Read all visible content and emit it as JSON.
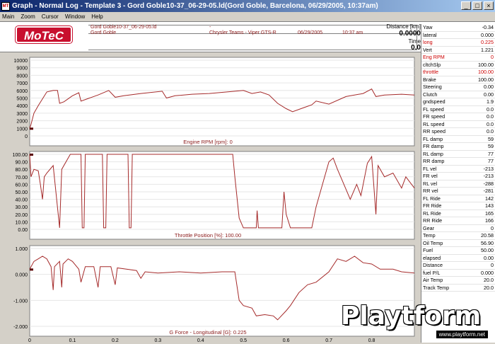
{
  "window": {
    "title": "Graph - Normal Log - Template 3 - Gord Goble10-37_06-29-05.ld(Gord Goble, Barcelona, 06/29/2005, 10:37am)",
    "icon_label": "MT",
    "buttons": {
      "minimize": "_",
      "maximize": "□",
      "close": "×"
    }
  },
  "menu": [
    "Main",
    "Zoom",
    "Cursor",
    "Window",
    "Help"
  ],
  "header": {
    "logo": "MoTeC",
    "file": "Gord Goble10-37_06-29-05.ld",
    "driver": "Gord Goble",
    "dash": "-",
    "team": "Chrysler Teams - Viper GTS-R",
    "date": "06/29/2005",
    "time": "10:37 am",
    "distance_label": "Distance [km]",
    "distance_value": "0.0000",
    "time_label": "Time",
    "time_value": "0.0"
  },
  "chart_data": [
    {
      "type": "line",
      "title": "Engine RPM [rpm]: 0",
      "ylim": [
        0,
        10000
      ],
      "yticks": [
        "10000",
        "9000",
        "8000",
        "7000",
        "6000",
        "5000",
        "4000",
        "3000",
        "2000",
        "1000",
        "0"
      ],
      "series": [
        {
          "values_xy": [
            [
              0,
              1000
            ],
            [
              0.003,
              1500
            ],
            [
              0.01,
              3000
            ],
            [
              0.02,
              4000
            ],
            [
              0.04,
              5800
            ],
            [
              0.055,
              6000
            ],
            [
              0.065,
              6000
            ],
            [
              0.07,
              4300
            ],
            [
              0.08,
              4500
            ],
            [
              0.1,
              5300
            ],
            [
              0.115,
              5700
            ],
            [
              0.12,
              4600
            ],
            [
              0.14,
              5000
            ],
            [
              0.16,
              5400
            ],
            [
              0.185,
              6000
            ],
            [
              0.2,
              5100
            ],
            [
              0.22,
              5300
            ],
            [
              0.26,
              5600
            ],
            [
              0.31,
              5900
            ],
            [
              0.32,
              5000
            ],
            [
              0.34,
              5300
            ],
            [
              0.38,
              5500
            ],
            [
              0.42,
              5600
            ],
            [
              0.48,
              5900
            ],
            [
              0.5,
              6000
            ],
            [
              0.52,
              5600
            ],
            [
              0.54,
              5800
            ],
            [
              0.56,
              5400
            ],
            [
              0.58,
              4300
            ],
            [
              0.6,
              3600
            ],
            [
              0.615,
              3200
            ],
            [
              0.64,
              3700
            ],
            [
              0.66,
              4100
            ],
            [
              0.67,
              4600
            ],
            [
              0.7,
              4200
            ],
            [
              0.74,
              5200
            ],
            [
              0.78,
              5600
            ],
            [
              0.8,
              6200
            ],
            [
              0.81,
              5200
            ],
            [
              0.83,
              5400
            ],
            [
              0.87,
              5500
            ],
            [
              0.9,
              5400
            ]
          ]
        }
      ]
    },
    {
      "type": "line",
      "title": "Throttle Position [%]: 100.00",
      "ylim": [
        0,
        100
      ],
      "yticks": [
        "100.00",
        "90.00",
        "80.00",
        "70.00",
        "60.00",
        "50.00",
        "40.00",
        "30.00",
        "20.00",
        "10.00",
        "0.00"
      ],
      "series": [
        {
          "values_xy": [
            [
              0,
              100
            ],
            [
              0.003,
              70
            ],
            [
              0.01,
              80
            ],
            [
              0.02,
              78
            ],
            [
              0.025,
              60
            ],
            [
              0.03,
              40
            ],
            [
              0.034,
              70
            ],
            [
              0.04,
              75
            ],
            [
              0.055,
              85
            ],
            [
              0.07,
              2
            ],
            [
              0.075,
              80
            ],
            [
              0.095,
              100
            ],
            [
              0.12,
              100
            ],
            [
              0.123,
              2
            ],
            [
              0.127,
              2
            ],
            [
              0.13,
              100
            ],
            [
              0.17,
              100
            ],
            [
              0.173,
              2
            ],
            [
              0.178,
              2
            ],
            [
              0.181,
              100
            ],
            [
              0.23,
              100
            ],
            [
              0.233,
              2
            ],
            [
              0.237,
              2
            ],
            [
              0.24,
              100
            ],
            [
              0.3,
              100
            ],
            [
              0.44,
              100
            ],
            [
              0.475,
              100
            ],
            [
              0.48,
              70
            ],
            [
              0.49,
              15
            ],
            [
              0.5,
              2
            ],
            [
              0.53,
              2
            ],
            [
              0.532,
              25
            ],
            [
              0.535,
              2
            ],
            [
              0.59,
              2
            ],
            [
              0.595,
              50
            ],
            [
              0.6,
              20
            ],
            [
              0.61,
              2
            ],
            [
              0.66,
              2
            ],
            [
              0.67,
              30
            ],
            [
              0.7,
              90
            ],
            [
              0.71,
              95
            ],
            [
              0.72,
              80
            ],
            [
              0.735,
              60
            ],
            [
              0.75,
              40
            ],
            [
              0.765,
              60
            ],
            [
              0.775,
              45
            ],
            [
              0.79,
              88
            ],
            [
              0.8,
              97
            ],
            [
              0.81,
              20
            ],
            [
              0.815,
              85
            ],
            [
              0.83,
              70
            ],
            [
              0.85,
              75
            ],
            [
              0.87,
              55
            ],
            [
              0.88,
              70
            ],
            [
              0.9,
              55
            ]
          ]
        }
      ]
    },
    {
      "type": "line",
      "title": "G Force - Longitudinal [G]: 0.225",
      "ylim": [
        -2,
        1
      ],
      "yticks": [
        "1.000",
        "0.000",
        "-1.000",
        "-2.000"
      ],
      "xlim": [
        0,
        0.9
      ],
      "xticks": [
        "0",
        "0.1",
        "0.2",
        "0.3",
        "0.4",
        "0.5",
        "0.6",
        "0.7",
        "0.8"
      ],
      "series": [
        {
          "values_xy": [
            [
              0,
              0.2
            ],
            [
              0.01,
              0.5
            ],
            [
              0.02,
              0.6
            ],
            [
              0.03,
              0.7
            ],
            [
              0.04,
              0.6
            ],
            [
              0.05,
              0.3
            ],
            [
              0.055,
              -0.6
            ],
            [
              0.058,
              0.3
            ],
            [
              0.07,
              0.5
            ],
            [
              0.075,
              -0.5
            ],
            [
              0.078,
              0.4
            ],
            [
              0.09,
              0.6
            ],
            [
              0.1,
              0.5
            ],
            [
              0.115,
              0.2
            ],
            [
              0.12,
              -0.3
            ],
            [
              0.13,
              0.3
            ],
            [
              0.15,
              0.3
            ],
            [
              0.16,
              -0.5
            ],
            [
              0.165,
              0.3
            ],
            [
              0.19,
              0.3
            ],
            [
              0.2,
              -0.4
            ],
            [
              0.205,
              0.25
            ],
            [
              0.25,
              0.15
            ],
            [
              0.26,
              -0.15
            ],
            [
              0.27,
              0.1
            ],
            [
              0.3,
              0.05
            ],
            [
              0.35,
              0.1
            ],
            [
              0.4,
              0.05
            ],
            [
              0.45,
              0.1
            ],
            [
              0.48,
              0.1
            ],
            [
              0.49,
              -1.0
            ],
            [
              0.5,
              -1.2
            ],
            [
              0.52,
              -1.3
            ],
            [
              0.53,
              -1.6
            ],
            [
              0.55,
              -1.55
            ],
            [
              0.57,
              -1.6
            ],
            [
              0.58,
              -1.75
            ],
            [
              0.6,
              -1.4
            ],
            [
              0.61,
              -1.2
            ],
            [
              0.63,
              -0.7
            ],
            [
              0.65,
              -0.4
            ],
            [
              0.67,
              -0.3
            ],
            [
              0.7,
              0.1
            ],
            [
              0.72,
              0.6
            ],
            [
              0.74,
              0.5
            ],
            [
              0.76,
              0.7
            ],
            [
              0.78,
              0.45
            ],
            [
              0.8,
              0.4
            ],
            [
              0.82,
              0.2
            ],
            [
              0.85,
              0.2
            ],
            [
              0.87,
              0.1
            ],
            [
              0.9,
              0.05
            ]
          ]
        }
      ]
    }
  ],
  "channels": [
    {
      "name": "Yaw",
      "value": "-0.34",
      "red": false
    },
    {
      "name": "lateral",
      "value": "0.000",
      "red": false
    },
    {
      "name": "long",
      "value": "0.225",
      "red": true
    },
    {
      "name": "Vert",
      "value": "1.221",
      "red": false
    },
    {
      "name": "Eng RPM",
      "value": "0",
      "red": true
    },
    {
      "name": "cltchSlp",
      "value": "100.00",
      "red": false
    },
    {
      "name": "throttle",
      "value": "100.00",
      "red": true
    },
    {
      "name": "Brake",
      "value": "100.00",
      "red": false
    },
    {
      "name": "Steering",
      "value": "0.00",
      "red": false
    },
    {
      "name": "Clutch",
      "value": "0.00",
      "red": false
    },
    {
      "name": "gndspeed",
      "value": "1.9",
      "red": false
    },
    {
      "name": "FL speed",
      "value": "0.0",
      "red": false
    },
    {
      "name": "FR speed",
      "value": "0.0",
      "red": false
    },
    {
      "name": "RL speed",
      "value": "0.0",
      "red": false
    },
    {
      "name": "RR speed",
      "value": "0.0",
      "red": false
    },
    {
      "name": "FL damp",
      "value": "59",
      "red": false
    },
    {
      "name": "FR damp",
      "value": "59",
      "red": false
    },
    {
      "name": "RL damp",
      "value": "77",
      "red": false
    },
    {
      "name": "RR damp",
      "value": "77",
      "red": false
    },
    {
      "name": "FL vel",
      "value": "-213",
      "red": false
    },
    {
      "name": "FR vel",
      "value": "-213",
      "red": false
    },
    {
      "name": "RL vel",
      "value": "-288",
      "red": false
    },
    {
      "name": "RR vel",
      "value": "-281",
      "red": false
    },
    {
      "name": "FL Ride",
      "value": "142",
      "red": false
    },
    {
      "name": "FR Ride",
      "value": "143",
      "red": false
    },
    {
      "name": "RL Ride",
      "value": "165",
      "red": false
    },
    {
      "name": "RR Ride",
      "value": "166",
      "red": false
    },
    {
      "name": "Gear",
      "value": "0",
      "red": false
    },
    {
      "name": "Temp",
      "value": "20.58",
      "red": false
    },
    {
      "name": "Oil Temp",
      "value": "56.90",
      "red": false
    },
    {
      "name": "Fuel",
      "value": "50.00",
      "red": false
    },
    {
      "name": "elapsed",
      "value": "0.00",
      "red": false
    },
    {
      "name": "Distance",
      "value": "0",
      "red": false
    },
    {
      "name": "fuel P/L",
      "value": "0.000",
      "red": false
    },
    {
      "name": "Air Temp",
      "value": "20.0",
      "red": false
    },
    {
      "name": "Track Temp",
      "value": "20.0",
      "red": false
    }
  ],
  "watermark": {
    "brand": "Playtform",
    "url": "www.playtform.net"
  },
  "colors": {
    "trace": "#a52a2a",
    "accent": "#c8102e",
    "titlebar": "#0a246a"
  }
}
